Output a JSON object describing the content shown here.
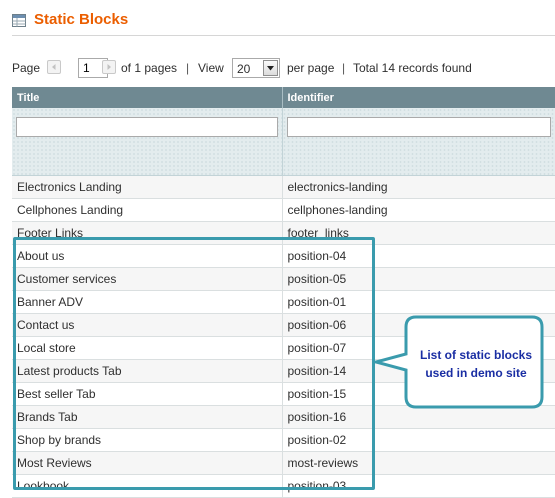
{
  "header": {
    "title": "Static Blocks"
  },
  "pager": {
    "page_label": "Page",
    "current_page": "1",
    "of_pages": "of 1 pages",
    "sep1": "|",
    "view_label": "View",
    "per_page_value": "20",
    "per_page_label": "per page",
    "sep2": "|",
    "total": "Total 14 records found"
  },
  "grid": {
    "columns": [
      "Title",
      "Identifier"
    ],
    "rows": [
      {
        "title": "Electronics Landing",
        "identifier": "electronics-landing"
      },
      {
        "title": "Cellphones Landing",
        "identifier": "cellphones-landing"
      },
      {
        "title": "Footer Links",
        "identifier": "footer_links"
      },
      {
        "title": "About us",
        "identifier": "position-04"
      },
      {
        "title": "Customer services",
        "identifier": "position-05"
      },
      {
        "title": "Banner ADV",
        "identifier": "position-01"
      },
      {
        "title": "Contact us",
        "identifier": "position-06"
      },
      {
        "title": "Local store",
        "identifier": "position-07"
      },
      {
        "title": "Latest products Tab",
        "identifier": "position-14"
      },
      {
        "title": "Best seller Tab",
        "identifier": "position-15"
      },
      {
        "title": "Brands Tab",
        "identifier": "position-16"
      },
      {
        "title": "Shop by brands",
        "identifier": "position-02"
      },
      {
        "title": "Most Reviews",
        "identifier": "most-reviews"
      },
      {
        "title": "Lookbook",
        "identifier": "position-03"
      }
    ]
  },
  "callout": {
    "line1": "List of static blocks",
    "line2": "used in demo site",
    "border_color": "#3a9bad",
    "text_color": "#1a2ea3"
  },
  "colors": {
    "title": "#eb5e00",
    "grid_header": "#6f8992",
    "highlight": "#3a9bad"
  },
  "icons": [
    "grid-table-icon",
    "arrow-left-icon",
    "arrow-right-icon",
    "dropdown-arrow-icon"
  ]
}
